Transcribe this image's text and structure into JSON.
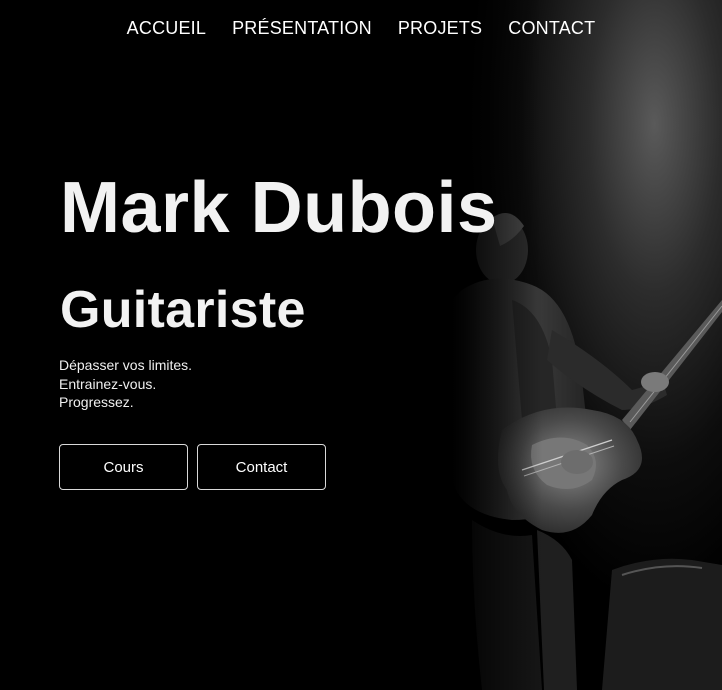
{
  "nav": {
    "items": [
      {
        "label": "ACCUEIL"
      },
      {
        "label": "PRÉSENTATION"
      },
      {
        "label": "PROJETS"
      },
      {
        "label": "CONTACT"
      }
    ]
  },
  "hero": {
    "name": "Mark Dubois",
    "role": "Guitariste",
    "tagline": [
      "Dépasser vos limites.",
      "Entrainez-vous.",
      "Progressez."
    ],
    "buttons": {
      "cours": "Cours",
      "contact": "Contact"
    }
  },
  "colors": {
    "background": "#000000",
    "text": "#ffffff",
    "button_border": "#d9d9d9"
  }
}
